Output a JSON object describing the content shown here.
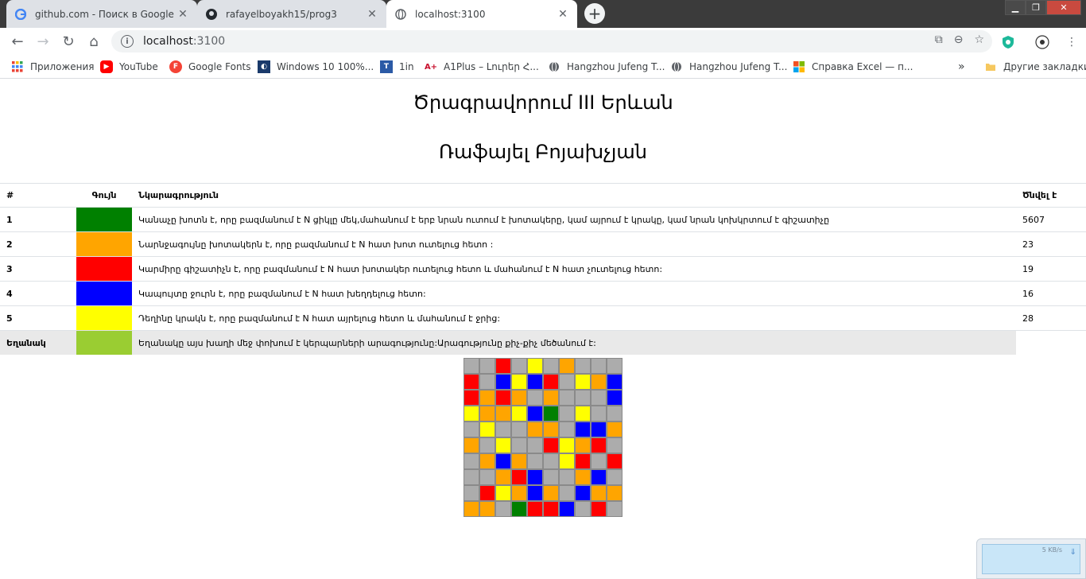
{
  "browser": {
    "tabs": [
      {
        "title": "github.com - Поиск в Google",
        "icon": "google-icon"
      },
      {
        "title": "rafayelboyakh15/prog3",
        "icon": "github-icon"
      },
      {
        "title": "localhost:3100",
        "icon": "globe-icon",
        "active": true
      }
    ],
    "address": {
      "host": "localhost",
      "port": ":3100"
    },
    "bookmarks": [
      {
        "label": "Приложения",
        "icon": "apps-grid-icon"
      },
      {
        "label": "YouTube",
        "icon": "youtube-icon",
        "color": "#ff0000"
      },
      {
        "label": "Google Fonts",
        "icon": "google-fonts-icon",
        "color": "#f44336"
      },
      {
        "label": "Windows 10 100%...",
        "icon": "windows-site-icon",
        "color": "#1a3a6b"
      },
      {
        "label": "1in",
        "icon": "1in-icon",
        "color": "#2b5aa6"
      },
      {
        "label": "A1Plus – Լուրեր Հ...",
        "icon": "a1plus-icon",
        "color": "#c8102e"
      },
      {
        "label": "Hangzhou Jufeng T...",
        "icon": "globe-icon"
      },
      {
        "label": "Hangzhou Jufeng T...",
        "icon": "globe-icon"
      },
      {
        "label": "Справка Excel — п...",
        "icon": "microsoft-icon"
      }
    ],
    "bookmarks_overflow": "»",
    "other_bookmarks": "Другие закладки"
  },
  "page": {
    "title_line1": "Ծրագրավորում III Երևան",
    "title_line2": "Ռաֆայել Բոյախչյան",
    "table": {
      "headers": [
        "#",
        "Գույն",
        "Նկարագրություն",
        "Ծնվել է"
      ],
      "rows": [
        {
          "num": "1",
          "color": "#008000",
          "desc": "Կանաչը խոտն է, որը բազմանում է N ցիկլը մեկ,մահանում է երբ նրան ուտում է խոտակերը, կամ այրում է կրակը, կամ նրան կոխկրտում է գիշատիչը",
          "born": "5607"
        },
        {
          "num": "2",
          "color": "#ffa500",
          "desc": "Նարնջագույնը խոտակերն է, որը բազմանում է N հատ խոտ ուտելուց հետո :",
          "born": "23"
        },
        {
          "num": "3",
          "color": "#ff0000",
          "desc": "Կարմիրը գիշատիչն է, որը բազմանում է N հատ խոտակեր ուտելուց հետո և մահանում է N հատ չուտելուց հետո:",
          "born": "19"
        },
        {
          "num": "4",
          "color": "#0000ff",
          "desc": "Կապույտը ջուրն է, որը բազմանում է N հատ խեղդելուց հետո:",
          "born": "16"
        },
        {
          "num": "5",
          "color": "#ffff00",
          "desc": "Դեղինը կրակն է, որը բազմանում է N հատ այրելուց հետո և մահանում է ջրից:",
          "born": "28"
        }
      ],
      "weather_row": {
        "label": "Եղանակ",
        "color": "#9acd32",
        "desc": "Եղանակը այս խաղի մեջ փոխում է կերպարների արագությունը:Արագությունը քիչ-քիչ մեծանում է:"
      }
    },
    "grid": [
      "GGRGYGOGGG",
      "RGBYBRGYOB",
      "ROROGOGGGB",
      "YOOYBNGYGG",
      "GYGGOOGBBO",
      "OGYGGRYORG",
      "GOBOGGYRGR",
      "GGORBGGOBG",
      "GRYOBOGBOO",
      "OOGNRRBGRG"
    ],
    "grid_colors": {
      "G": "#acacac",
      "R": "#ff0000",
      "Y": "#ffff00",
      "O": "#ffa500",
      "B": "#0000ff",
      "N": "#008000"
    }
  },
  "download_widget": {
    "speed": "5 KB/s"
  }
}
